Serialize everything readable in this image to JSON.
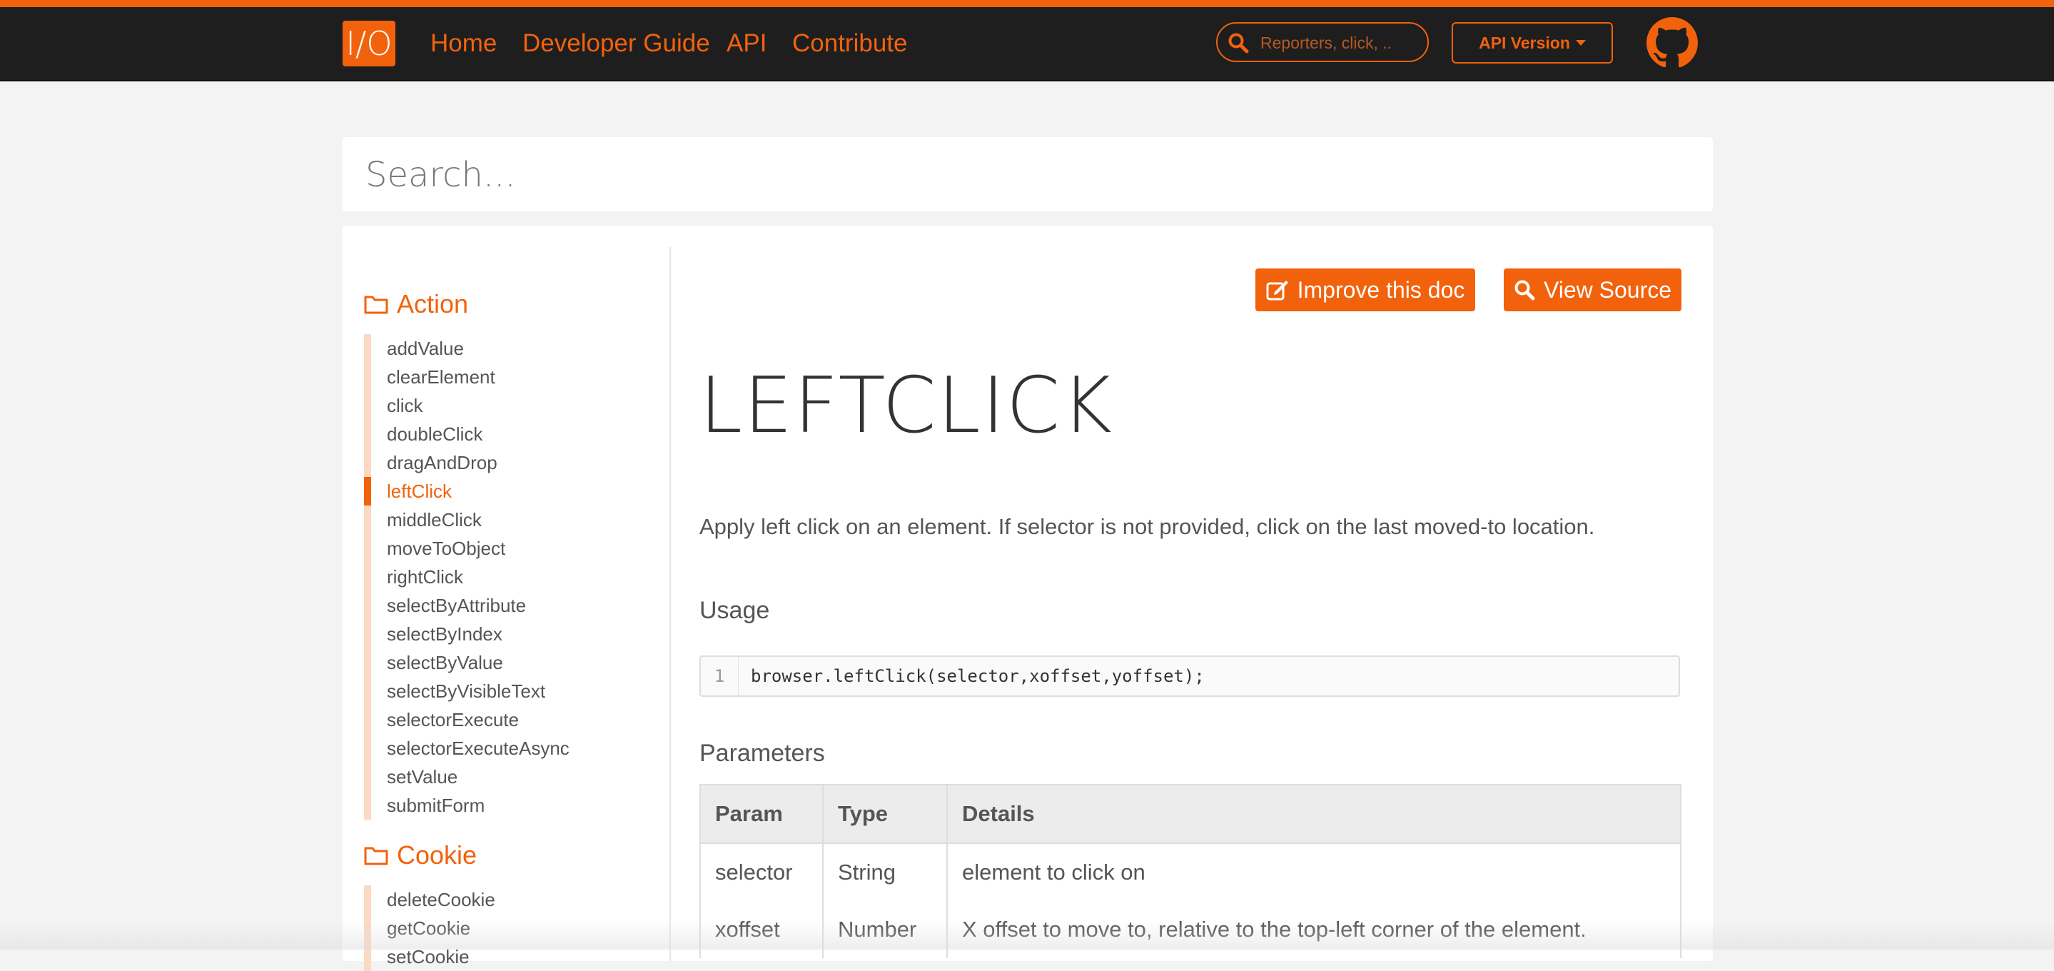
{
  "nav": {
    "logo_text": "I/O",
    "links": [
      "Home",
      "Developer Guide",
      "API",
      "Contribute"
    ],
    "search_placeholder": "Reporters, click, ..",
    "api_version_label": "API Version",
    "brand_color": "#f2620d"
  },
  "search": {
    "placeholder": "Search..."
  },
  "sidebar": {
    "groups": [
      {
        "title": "Action",
        "items": [
          "addValue",
          "clearElement",
          "click",
          "doubleClick",
          "dragAndDrop",
          "leftClick",
          "middleClick",
          "moveToObject",
          "rightClick",
          "selectByAttribute",
          "selectByIndex",
          "selectByValue",
          "selectByVisibleText",
          "selectorExecute",
          "selectorExecuteAsync",
          "setValue",
          "submitForm"
        ],
        "active_item": "leftClick"
      },
      {
        "title": "Cookie",
        "items": [
          "deleteCookie",
          "getCookie",
          "setCookie"
        ]
      }
    ]
  },
  "doc": {
    "improve_label": "Improve this doc",
    "view_source_label": "View Source",
    "title": "LEFTCLICK",
    "description": "Apply left click on an element. If selector is not provided, click on the last moved-to location.",
    "usage_heading": "Usage",
    "code_line_number": "1",
    "code": "browser.leftClick(selector,xoffset,yoffset);",
    "parameters_heading": "Parameters",
    "table": {
      "headers": [
        "Param",
        "Type",
        "Details"
      ],
      "rows": [
        [
          "selector",
          "String",
          "element to click on"
        ],
        [
          "xoffset",
          "Number",
          "X offset to move to, relative to the top-left corner of the element."
        ]
      ]
    }
  }
}
